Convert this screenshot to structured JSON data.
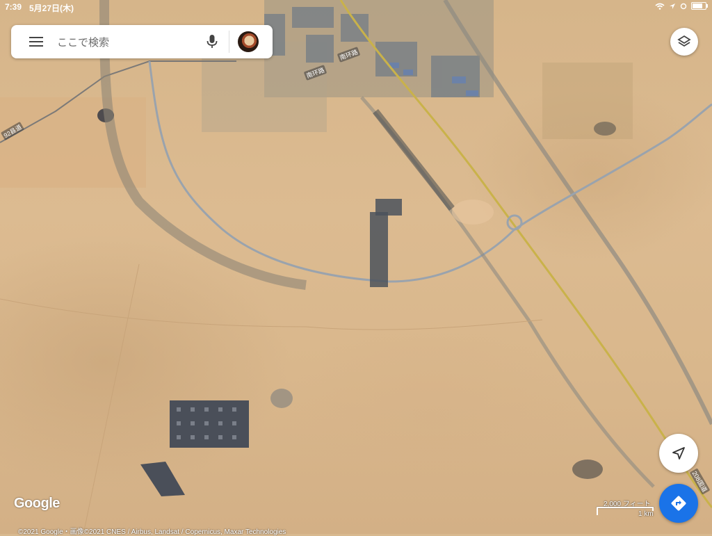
{
  "status_bar": {
    "time": "7:39",
    "date": "5月27日(木)"
  },
  "search": {
    "placeholder": "ここで検索"
  },
  "map": {
    "road_labels": [
      "92县道",
      "南环路",
      "南环路",
      "208国道"
    ]
  },
  "attribution": "©2021 Google・画像©2021 CNES / Airbus, Landsat / Copernicus, Maxar Technologies",
  "google_logo": "Google",
  "scale": {
    "imperial": "2,000 フィート",
    "metric": "1 km"
  },
  "icons": {
    "menu": "hamburger-menu-icon",
    "mic": "microphone-icon",
    "layers": "layers-icon",
    "compass": "navigation-arrow-icon",
    "directions": "directions-icon"
  },
  "colors": {
    "accent": "#1a73e8",
    "desert": "#d8b98f"
  }
}
